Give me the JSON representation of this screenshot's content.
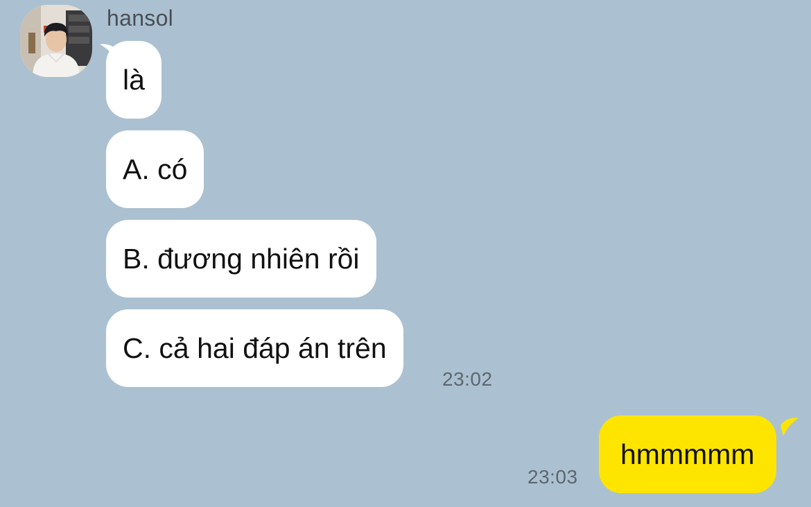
{
  "conversation": {
    "sender": {
      "name": "hansol",
      "avatar_icon": "profile-photo"
    },
    "incoming": [
      {
        "text": "là"
      },
      {
        "text": "A. có"
      },
      {
        "text": "B. đương nhiên rồi"
      },
      {
        "text": "C. cả hai đáp án trên",
        "time": "23:02"
      }
    ],
    "outgoing": [
      {
        "text": "hmmmmm",
        "time": "23:03"
      }
    ]
  },
  "colors": {
    "background": "#abc1d1",
    "incoming_bubble": "#ffffff",
    "outgoing_bubble": "#fee500",
    "timestamp": "#5d6670",
    "sender_name": "#4a4f55"
  }
}
